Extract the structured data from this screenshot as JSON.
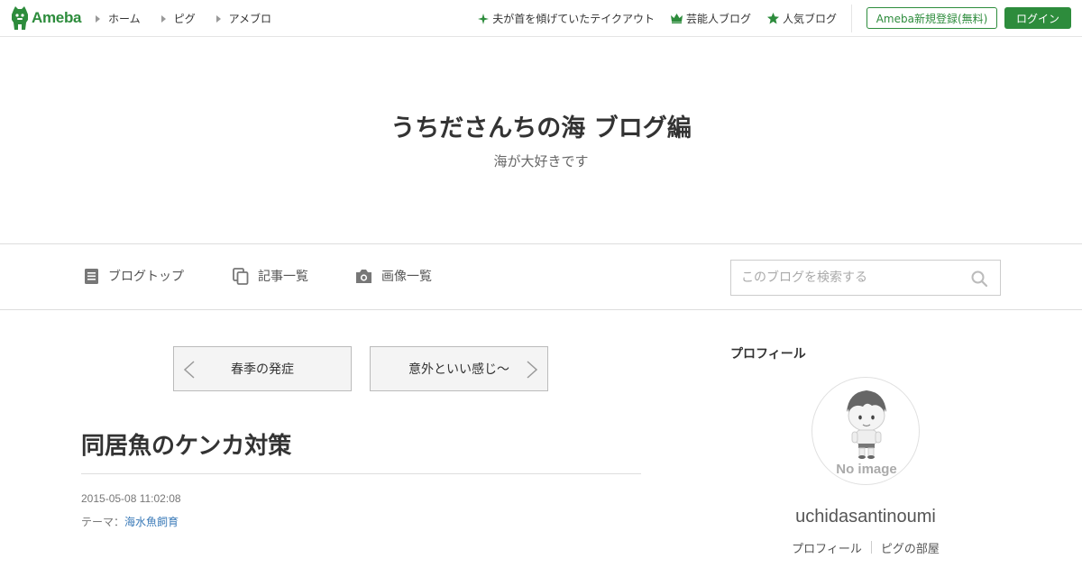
{
  "colors": {
    "brand": "#2d8c3c",
    "link": "#3a7ab8",
    "border": "#dddddd"
  },
  "topbar": {
    "logo": "Ameba",
    "nav": [
      {
        "label": "ホーム"
      },
      {
        "label": "ピグ"
      },
      {
        "label": "アメブロ"
      }
    ],
    "links": [
      {
        "label": "夫が首を傾げていたテイクアウト",
        "icon": "sparkle-icon"
      },
      {
        "label": "芸能人ブログ",
        "icon": "crown-icon"
      },
      {
        "label": "人気ブログ",
        "icon": "star-icon"
      }
    ],
    "register_label": "Ameba新規登録(無料)",
    "login_label": "ログイン"
  },
  "header": {
    "title": "うちださんちの海 ブログ編",
    "description": "海が大好きです"
  },
  "subnav": {
    "items": [
      {
        "label": "ブログトップ",
        "icon": "document-icon"
      },
      {
        "label": "記事一覧",
        "icon": "copy-icon"
      },
      {
        "label": "画像一覧",
        "icon": "camera-icon"
      }
    ],
    "search_placeholder": "このブログを検索する"
  },
  "pager": {
    "prev_label": "春季の発症",
    "next_label": "意外といい感じ～"
  },
  "entry": {
    "title": "同居魚のケンカ対策",
    "date": "2015-05-08 11:02:08",
    "theme_prefix": "テーマ：",
    "theme": "海水魚飼育"
  },
  "sidebar": {
    "heading": "プロフィール",
    "avatar_text": "No image",
    "username": "uchidasantinoumi",
    "links": [
      "プロフィール",
      "ピグの部屋"
    ]
  }
}
